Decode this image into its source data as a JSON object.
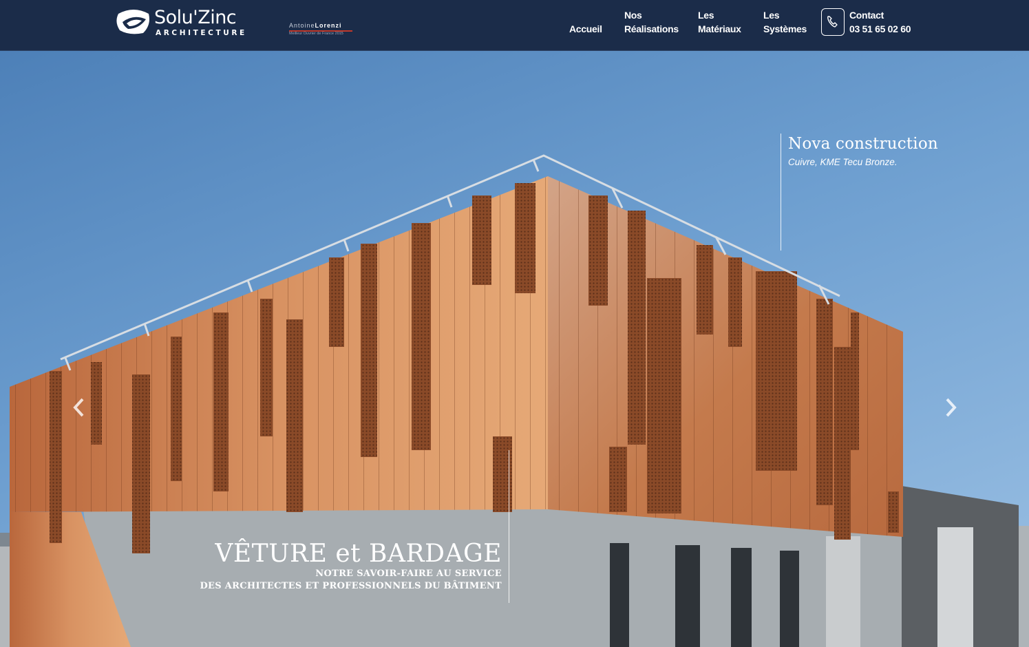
{
  "brand": {
    "name": "Solu'Zinc",
    "subtitle": "ARCHITECTURE",
    "partner_first": "Antoine",
    "partner_last": "Lorenzi",
    "partner_tag": "Meilleur Ouvrier de France 2015"
  },
  "nav": {
    "items": [
      {
        "line1": "",
        "line2": "Accueil"
      },
      {
        "line1": "Nos",
        "line2": "Réalisations"
      },
      {
        "line1": "Les",
        "line2": "Matériaux"
      },
      {
        "line1": "Les",
        "line2": "Systèmes"
      }
    ],
    "contact": {
      "label": "Contact",
      "phone": "03 51 65 02 60"
    }
  },
  "hero": {
    "project_title": "Nova construction",
    "project_sub": "Cuivre, KME Tecu Bronze.",
    "headline": "VÊTURE et BARDAGE",
    "tagline_1": "NOTRE SAVOIR-FAIRE AU SERVICE",
    "tagline_2": "DES ARCHITECTES ET PROFESSIONNELS DU BÂTIMENT"
  },
  "colors": {
    "header_bg": "#1b2c49",
    "copper": "#c77d4e",
    "sky": "#6e9fd0"
  },
  "icons": {
    "phone": "phone-icon",
    "prev": "chevron-left-icon",
    "next": "chevron-right-icon"
  }
}
